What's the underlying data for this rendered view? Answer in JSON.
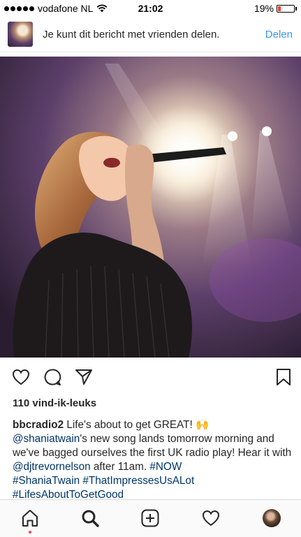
{
  "status_bar": {
    "carrier": "vodafone NL",
    "time": "21:02",
    "battery": "19%",
    "battery_level": 0.19
  },
  "share_banner": {
    "text": "Je kunt dit bericht met vrienden delen.",
    "button": "Delen"
  },
  "post": {
    "likes": "110 vind-ik-leuks",
    "caption": {
      "username": "bbcradio2",
      "line1": " Life's about to get GREAT! ",
      "emoji": "🙌",
      "mention1": "@shaniatwain",
      "text2": "'s new song lands tomorrow morning and we've bagged ourselves the first UK radio play! Hear it with ",
      "mention2": "@djtrevornelson",
      "text3": " after 11am. ",
      "tag1": "#NOW",
      "tag2": "#ShaniaTwain",
      "tag3": "#ThatImpressesUsALot",
      "tag4": "#LifesAboutToGetGood"
    }
  },
  "icons": {
    "like": "heart-icon",
    "comment": "comment-icon",
    "share": "paper-plane-icon",
    "save": "bookmark-icon",
    "home": "home-icon",
    "search": "search-icon",
    "add": "add-post-icon",
    "activity": "heart-icon"
  },
  "colors": {
    "link": "#003569",
    "action_blue": "#3897f0",
    "battery_low": "#ff3b30",
    "notification": "#ed4956"
  }
}
